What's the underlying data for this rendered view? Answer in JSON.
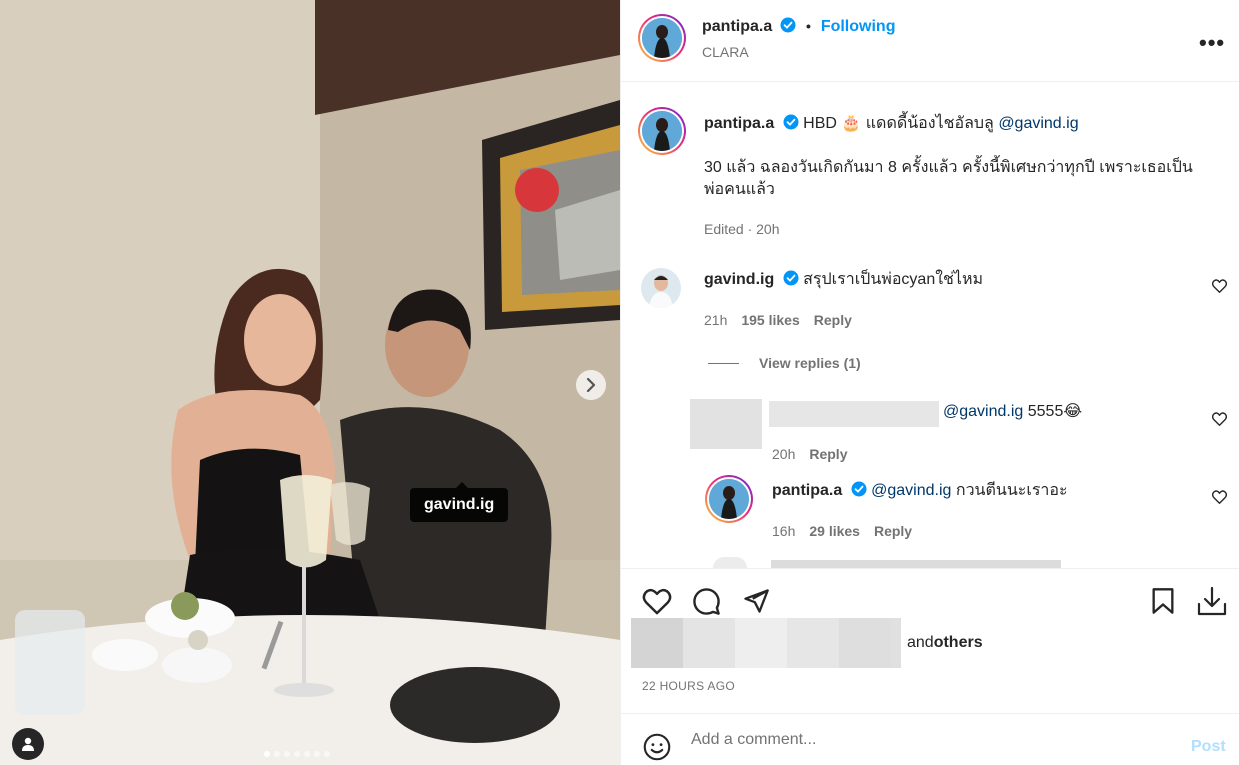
{
  "post": {
    "author": "pantipa.a",
    "follow_dot": "•",
    "follow_label": "Following",
    "location": "CLARA",
    "more_label": "•••",
    "tag_label": "gavind.ig",
    "slide_count": 7,
    "active_slide": 1
  },
  "caption": {
    "username": "pantipa.a",
    "line1_prefix": "HBD 🎂 แดดดี้น้องไชอัลบลู ",
    "line1_mention": "@gavind.ig",
    "line2": "30 แล้ว ฉลองวันเกิดกันมา 8 ครั้งแล้ว ครั้งนี้พิเศษกว่าทุกปี เพราะเธอเป็น",
    "line3": "พ่อคนแล้ว",
    "meta": "Edited · 20h"
  },
  "comments": [
    {
      "username": "gavind.ig",
      "text": "สรุปเราเป็นพ่อcyanใช่ไหม",
      "time": "21h",
      "likes": "195 likes",
      "reply": "Reply",
      "view_replies": "View replies (1)"
    },
    {
      "mention": "@gavind.ig",
      "text": " 5555😂",
      "time": "20h",
      "reply": "Reply"
    },
    {
      "username": "pantipa.a",
      "mention": "@gavind.ig",
      "text": " กวนตีนนะเราอะ",
      "time": "16h",
      "likes": "29 likes",
      "reply": "Reply"
    }
  ],
  "actions": {
    "and_label": "and ",
    "others_label": "others",
    "date": "22 HOURS AGO"
  },
  "composer": {
    "placeholder": "Add a comment...",
    "post_label": "Post"
  },
  "colors": {
    "accent": "#0095f6",
    "mention": "#00376b",
    "post_disabled": "#b2dffc",
    "verified": "#0095f6"
  }
}
